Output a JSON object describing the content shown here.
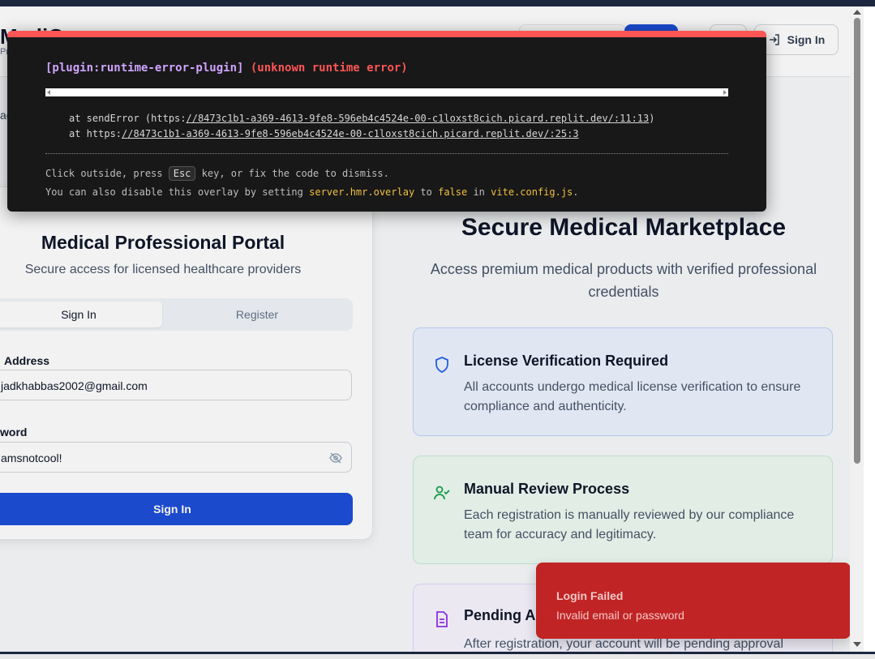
{
  "header": {
    "brand": "MediC",
    "brand_sub": "Pr",
    "signin_label": "Sign In"
  },
  "portal": {
    "title": "Medical Professional Portal",
    "subtitle": "Secure access for licensed healthcare providers",
    "tabs": [
      {
        "label": "Sign In",
        "active": true
      },
      {
        "label": "Register",
        "active": false
      }
    ],
    "email_label": "Address",
    "email_value": "jadkhabbas2002@gmail.com",
    "password_label": "word",
    "password_value": "amsnotcool!",
    "submit_label": "Sign In",
    "side_fragment": "ac"
  },
  "hero": {
    "title": "Secure Medical Marketplace",
    "subtitle": "Access premium medical products with verified professional credentials"
  },
  "features": [
    {
      "icon": "shield-icon",
      "title": "License Verification Required",
      "description": "All accounts undergo medical license verification to ensure compliance and authenticity."
    },
    {
      "icon": "user-check-icon",
      "title": "Manual Review Process",
      "description": "Each registration is manually reviewed by our compliance team for accuracy and legitimacy."
    },
    {
      "icon": "document-icon",
      "title": "Pending Ap",
      "description": "After registration, your account will be pending approval"
    }
  ],
  "error_overlay": {
    "plugin": "[plugin:runtime-error-plugin]",
    "message": "(unknown runtime error)",
    "stack": [
      {
        "prefix": "at sendError (https:",
        "link": "//8473c1b1-a369-4613-9fe8-596eb4c4524e-00-c1loxst8cich.picard.replit.dev/:11:13",
        "suffix": ")"
      },
      {
        "prefix": "at https:",
        "link": "//8473c1b1-a369-4613-9fe8-596eb4c4524e-00-c1loxst8cich.picard.replit.dev/:25:3",
        "suffix": ""
      }
    ],
    "tip1_before": "Click outside, press",
    "tip1_key": "Esc",
    "tip1_after": "key, or fix the code to dismiss.",
    "tip2_before": "You can also disable this overlay by setting",
    "tip2_setting": "server.hmr.overlay",
    "tip2_mid": "to",
    "tip2_value": "false",
    "tip2_in": "in",
    "tip2_file": "vite.config.js",
    "tip2_end": "."
  },
  "toast": {
    "title": "Login Failed",
    "message": "Invalid email or password"
  },
  "colors": {
    "primary": "#1d4ed8",
    "error": "#ff5555",
    "toast": "#c12424"
  }
}
